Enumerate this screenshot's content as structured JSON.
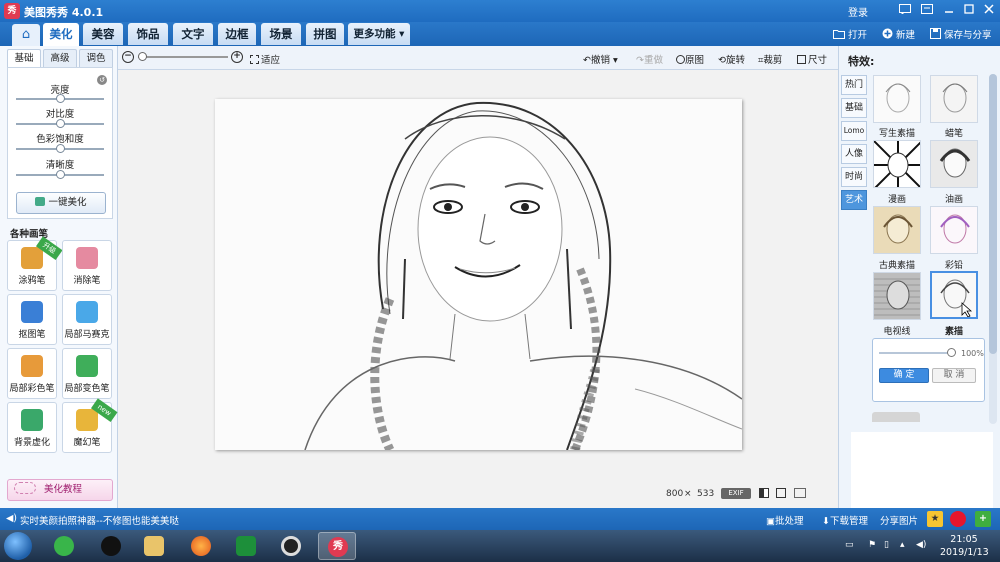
{
  "window": {
    "title": "美图秀秀 4.0.1",
    "app_icon": "秀",
    "login": "登录",
    "controls": [
      "message-icon",
      "menu-icon",
      "minimize-icon",
      "maximize-icon",
      "close-icon"
    ]
  },
  "nav": {
    "home_icon": "⌂",
    "tabs": [
      "美化",
      "美容",
      "饰品",
      "文字",
      "边框",
      "场景",
      "拼图",
      "更多功能 ▾"
    ],
    "active_tab": "美化",
    "right": {
      "open": "打开",
      "new": "新建",
      "save_share": "保存与分享"
    }
  },
  "toolbar": {
    "fit": "适应",
    "undo": "撤销",
    "redo": "重做",
    "original": "原图",
    "rotate": "旋转",
    "crop": "裁剪",
    "resize": "尺寸",
    "zoom_level": 0.0
  },
  "left_panel": {
    "tabs": [
      "基础",
      "高级",
      "调色"
    ],
    "active_tab": "基础",
    "adjustments": [
      {
        "label": "亮度",
        "value": 0.5
      },
      {
        "label": "对比度",
        "value": 0.5
      },
      {
        "label": "色彩饱和度",
        "value": 0.5
      },
      {
        "label": "清晰度",
        "value": 0.5
      }
    ],
    "one_key": "一键美化",
    "brushes_title": "各种画笔",
    "brushes": [
      {
        "label": "涂鸦笔",
        "badge": "升级",
        "color": "#e3a03a"
      },
      {
        "label": "消除笔",
        "badge": "",
        "color": "#e58aa0"
      },
      {
        "label": "抠图笔",
        "badge": "",
        "color": "#3a7fd6"
      },
      {
        "label": "局部马赛克",
        "badge": "",
        "color": "#4aa8e8"
      },
      {
        "label": "局部彩色笔",
        "badge": "",
        "color": "#e79a3a"
      },
      {
        "label": "局部变色笔",
        "badge": "",
        "color": "#3fae5a"
      },
      {
        "label": "背景虚化",
        "badge": "",
        "color": "#3aa86a"
      },
      {
        "label": "魔幻笔",
        "badge": "new",
        "color": "#e8b53a"
      }
    ],
    "tutorial": "美化教程"
  },
  "canvas": {
    "width": "800",
    "times": "×",
    "height": "533",
    "exif": "EXIF"
  },
  "right_panel": {
    "title": "特效:",
    "categories": [
      "热门",
      "基础",
      "Lomo",
      "人像",
      "时尚",
      "艺术"
    ],
    "active_category": "艺术",
    "effects": [
      {
        "label": "写生素描",
        "style": "sketch-light"
      },
      {
        "label": "蜡笔",
        "style": "sketch-light"
      },
      {
        "label": "漫画",
        "style": "comic"
      },
      {
        "label": "油画",
        "style": "oil"
      },
      {
        "label": "古典素描",
        "style": "classic"
      },
      {
        "label": "彩铅",
        "style": "color-pencil"
      },
      {
        "label": "电视线",
        "style": "tv"
      },
      {
        "label": "素描",
        "style": "sketch"
      }
    ],
    "selected_effect": "素描",
    "opacity_text": "100%",
    "opacity": 1.0,
    "ok": "确 定",
    "cancel": "取 消"
  },
  "statusbar": {
    "message": "实时美颜拍照神器--不修图也能美美哒",
    "batch": "批处理",
    "download": "下载管理",
    "share": "分享图片"
  },
  "taskbar": {
    "time": "21:05",
    "date": "2019/1/13",
    "active_app": "秀"
  },
  "colors": {
    "title_blue": "#1f6cc0",
    "accent": "#4a90e2",
    "brand_red": "#e03a52"
  }
}
